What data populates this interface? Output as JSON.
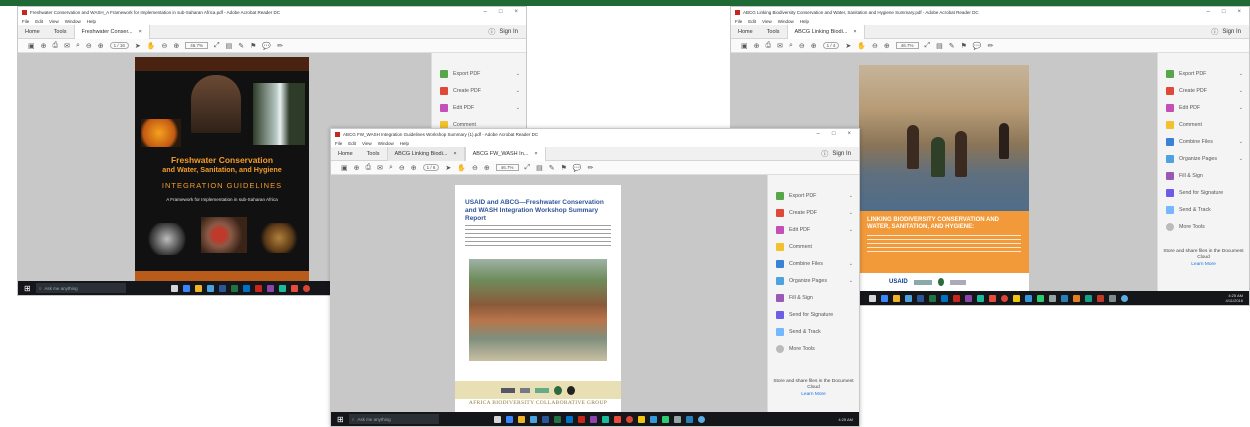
{
  "win_left": {
    "title": "Freshwater Conservation and WASH_A Framework for Implementation in sub-Saharan Africa.pdf - Adobe Acrobat Reader DC",
    "menu": [
      "File",
      "Edit",
      "View",
      "Window",
      "Help"
    ],
    "tabs": {
      "home": "Home",
      "tools": "Tools",
      "doc": "Freshwater Conser..."
    },
    "sign_in": "Sign In",
    "page_indicator": "1 / 16",
    "zoom": "46.7%",
    "pane": [
      "Export PDF",
      "Create PDF",
      "Edit PDF",
      "Comment"
    ],
    "cover": {
      "title_line1": "Freshwater Conservation",
      "title_line2": "and Water, Sanitation, and Hygiene",
      "subtitle": "INTEGRATION GUIDELINES",
      "framework": "A Framework for Implementation in sub-Saharan Africa"
    },
    "taskbar_search": "Ask me anything"
  },
  "win_right": {
    "title": "ABCG Linking Biodiversity Conservation and Water, Sanitation and Hygiene Summary.pdf - Adobe Acrobat Reader DC",
    "menu": [
      "File",
      "Edit",
      "View",
      "Window",
      "Help"
    ],
    "tabs": {
      "home": "Home",
      "tools": "Tools",
      "doc": "ABCG Linking Biodi..."
    },
    "sign_in": "Sign In",
    "page_indicator": "1 / 4",
    "zoom": "46.7%",
    "pane": [
      "Export PDF",
      "Create PDF",
      "Edit PDF",
      "Comment",
      "Combine Files",
      "Organize Pages",
      "Fill & Sign",
      "Send for Signature",
      "Send & Track",
      "More Tools"
    ],
    "pane_foot": "Store and share files in the Document Cloud",
    "learn_more": "Learn More",
    "cover": {
      "title": "LINKING BIODIVERSITY CONSERVATION AND WATER, SANITATION, AND HYGIENE:",
      "usaid": "USAID"
    },
    "clock_time": "4:25 AM",
    "clock_date": "4/11/2016"
  },
  "win_center": {
    "title": "ABCG FW_WASH Integration Guidelines Workshop Summary (1).pdf - Adobe Acrobat Reader DC",
    "menu": [
      "File",
      "Edit",
      "View",
      "Window",
      "Help"
    ],
    "tabs": {
      "home": "Home",
      "tools": "Tools",
      "doc_inactive": "ABCG Linking Biodi...",
      "doc": "ABCG FW_WASH In..."
    },
    "sign_in": "Sign In",
    "page_indicator": "1 / 6",
    "zoom": "46.7%",
    "pane": [
      "Export PDF",
      "Create PDF",
      "Edit PDF",
      "Comment",
      "Combine Files",
      "Organize Pages",
      "Fill & Sign",
      "Send for Signature",
      "Send & Track",
      "More Tools"
    ],
    "pane_foot": "Store and share files in the Document Cloud",
    "learn_more": "Learn More",
    "report": {
      "title": "USAID and ABCG—Freshwater Conservation and WASH Integration Workshop Summary Report",
      "footer": "AFRICA BIODIVERSITY COLLABORATIVE GROUP"
    },
    "taskbar_search": "Ask me anything",
    "clock_time": "4:25 AM"
  },
  "colors": {
    "accent_green": "#1f6a34",
    "acrobat_red": "#c8261c",
    "link_blue": "#1473e6"
  }
}
